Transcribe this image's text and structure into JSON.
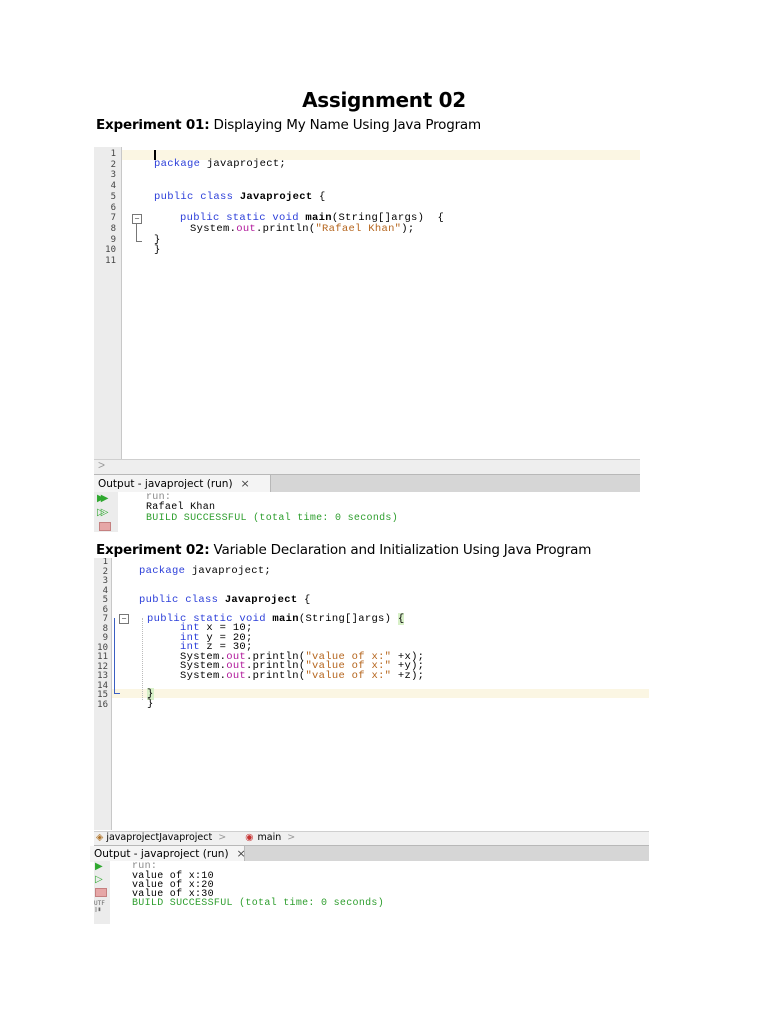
{
  "document": {
    "title": "Assignment 02"
  },
  "experiment1": {
    "label": "Experiment 01:",
    "description": "Displaying My Name Using Java Program",
    "line_numbers": [
      "1",
      "2",
      "3",
      "4",
      "5",
      "6",
      "7",
      "8",
      "9",
      "10",
      "11"
    ],
    "code": {
      "l2_kw": "package",
      "l2_rest": " javaproject;",
      "l5_kw": "public class",
      "l5_name": " Javaproject",
      "l5_rest": " {",
      "l7_kw": "public static void",
      "l7_name": " main",
      "l7_rest": "(String[]args)  {",
      "l8_a": "System.",
      "l8_fld": "out",
      "l8_b": ".println(",
      "l8_str": "\"Rafael Khan\"",
      "l8_c": ");",
      "l9": "}",
      "l10": "}"
    },
    "output": {
      "tab_label": "Output - javaproject (run)",
      "close": "×",
      "lines": [
        "run:",
        "Rafael Khan",
        "BUILD SUCCESSFUL (total time: 0 seconds)"
      ]
    }
  },
  "experiment2": {
    "label": "Experiment 02:",
    "description": "Variable Declaration and Initialization Using Java Program",
    "line_numbers": [
      "1",
      "2",
      "3",
      "4",
      "5",
      "6",
      "7",
      "8",
      "9",
      "10",
      "11",
      "12",
      "13",
      "14",
      "15",
      "16"
    ],
    "code": {
      "l2_kw": "package",
      "l2_rest": " javaproject;",
      "l5_kw": "public class",
      "l5_name": " Javaproject",
      "l5_rest": " {",
      "l7_kw": "public static void",
      "l7_name": " main",
      "l7_rest": "(String[]args)",
      "l7_brace": "{",
      "l8_kw": "int",
      "l8_rest": " x = 10;",
      "l9_kw": "int",
      "l9_rest": " y = 20;",
      "l10_kw": "int",
      "l10_rest": " z = 30;",
      "l11_a": "System.",
      "l11_fld": "out",
      "l11_b": ".println(",
      "l11_str": "\"value of x:\"",
      "l11_c": " +x);",
      "l12_a": "System.",
      "l12_fld": "out",
      "l12_b": ".println(",
      "l12_str": "\"value of x:\"",
      "l12_c": " +y);",
      "l13_a": "System.",
      "l13_fld": "out",
      "l13_b": ".println(",
      "l13_str": "\"value of x:\"",
      "l13_c": " +z);",
      "l15": "}",
      "l16": "}"
    },
    "breadcrumb": {
      "class": "javaprojectJavaproject",
      "method": "main"
    },
    "output": {
      "tab_label": "Output - javaproject (run)",
      "close": "×",
      "lines": [
        "run:",
        "value of x:10",
        "value of x:20",
        "value of x:30",
        "BUILD SUCCESSFUL (total time: 0 seconds)"
      ]
    }
  }
}
